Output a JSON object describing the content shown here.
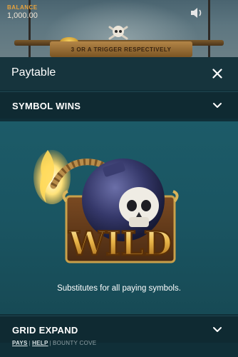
{
  "game": {
    "balance_label": "BALANCE",
    "balance_value": "1,000.00",
    "banner_text": "3 OR A TRIGGER RESPECTIVELY"
  },
  "paytable": {
    "title": "Paytable",
    "close_icon": "close-icon",
    "sections": [
      {
        "label": "SYMBOL WINS",
        "icon": "chevron-down-icon"
      },
      {
        "label": "GRID EXPAND",
        "icon": "chevron-down-icon"
      }
    ],
    "symbol": {
      "art_text": "WILD",
      "description": "Substitutes for all paying symbols."
    }
  },
  "footer": {
    "pays": "PAYS",
    "help": "HELP",
    "game_name": "BOUNTY COVE"
  },
  "colors": {
    "accent_gold": "#e8a33c",
    "sheet_bg": "#102f38",
    "section_bg": "#1a5562"
  }
}
